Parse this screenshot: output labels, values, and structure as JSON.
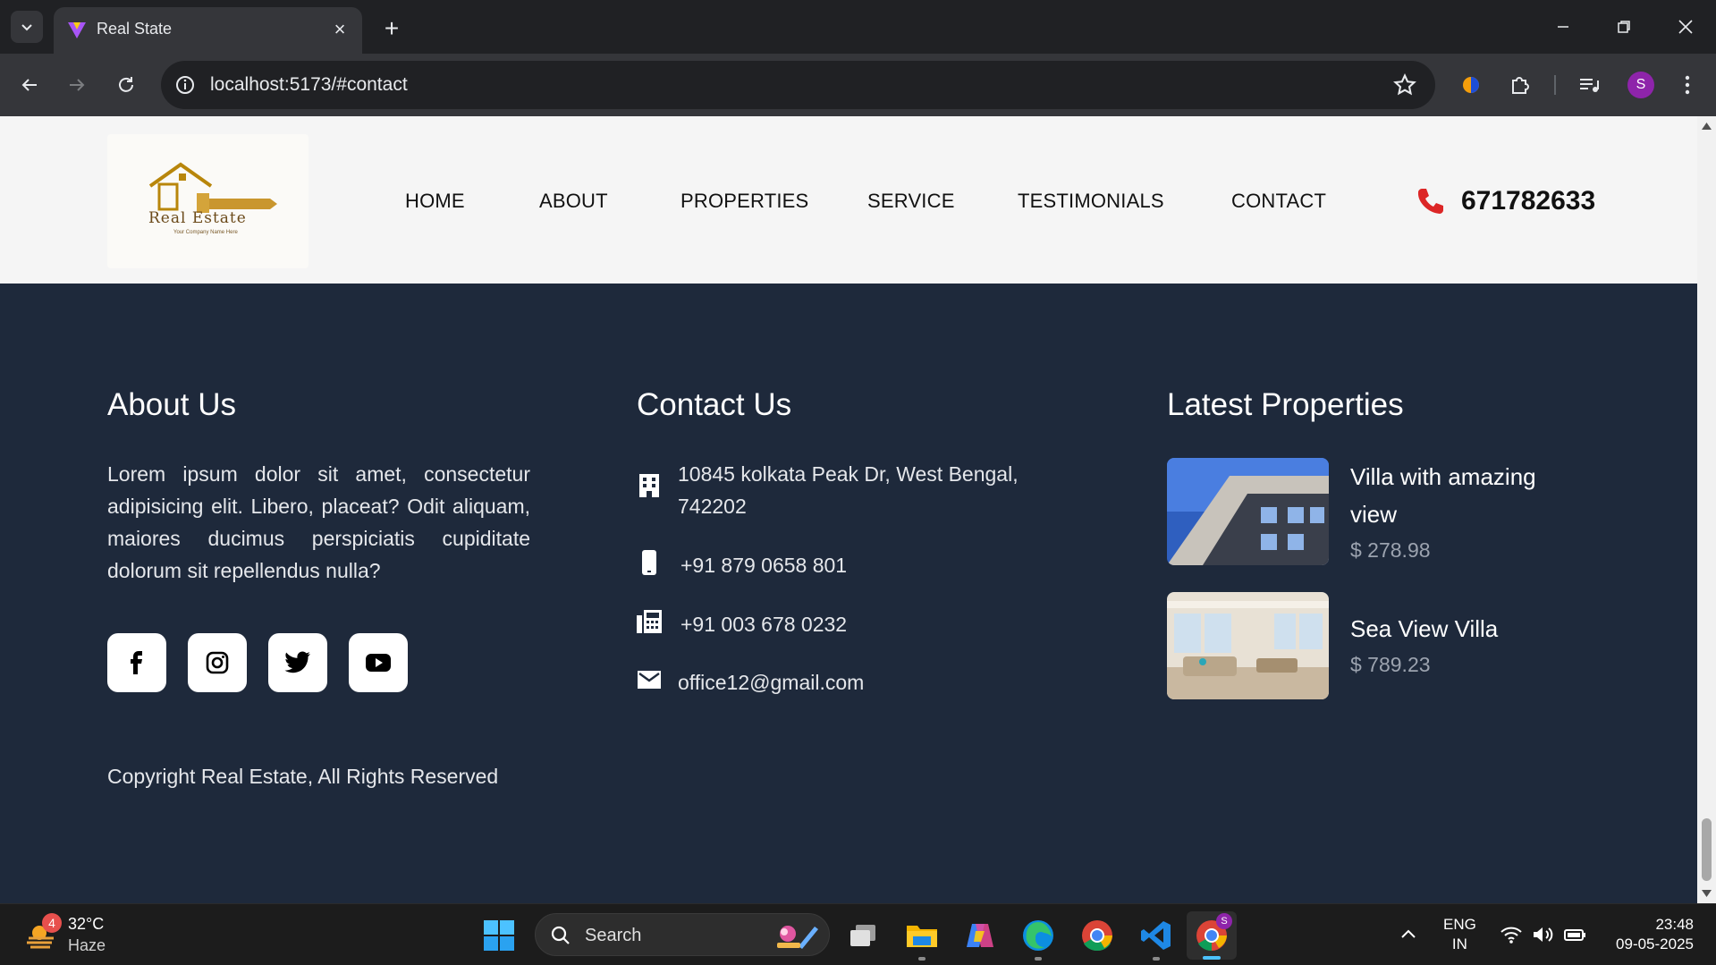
{
  "browser": {
    "tab_title": "Real State",
    "url": "localhost:5173/#contact",
    "profile_initial": "S"
  },
  "site": {
    "logo_text": "Real Estate",
    "logo_subtext": "Your Company Name Here",
    "nav": [
      "HOME",
      "ABOUT",
      "PROPERTIES",
      "SERVICE",
      "TESTIMONIALS",
      "CONTACT"
    ],
    "phone": "671782633"
  },
  "footer": {
    "about": {
      "title": "About Us",
      "text": "Lorem ipsum dolor sit amet, consectetur adipisicing elit. Libero, placeat? Odit aliquam, maiores ducimus perspiciatis cupiditate dolorum sit repellendus nulla?",
      "socials": [
        "facebook-icon",
        "instagram-icon",
        "twitter-icon",
        "youtube-icon"
      ]
    },
    "contact": {
      "title": "Contact Us",
      "address": "10845 kolkata Peak Dr, West Bengal, 742202",
      "phone": "+91 879 0658 801",
      "fax": "+91 003 678 0232",
      "email": "office12@gmail.com"
    },
    "latest": {
      "title": "Latest Properties",
      "items": [
        {
          "name": "Villa with amazing view",
          "price": "$ 278.98"
        },
        {
          "name": "Sea View Villa",
          "price": "$ 789.23"
        }
      ]
    },
    "copyright": "Copyright Real Estate, All Rights Reserved"
  },
  "taskbar": {
    "weather_badge": "4",
    "temperature": "32°C",
    "weather": "Haze",
    "search_label": "Search",
    "lang_line1": "ENG",
    "lang_line2": "IN",
    "time": "23:48",
    "date": "09-05-2025",
    "chrome_badge": "S"
  },
  "colors": {
    "footer_bg": "#1e293b",
    "header_bg": "#f5f5f5",
    "phone_accent": "#dc2626",
    "price": "#9ca3af"
  }
}
